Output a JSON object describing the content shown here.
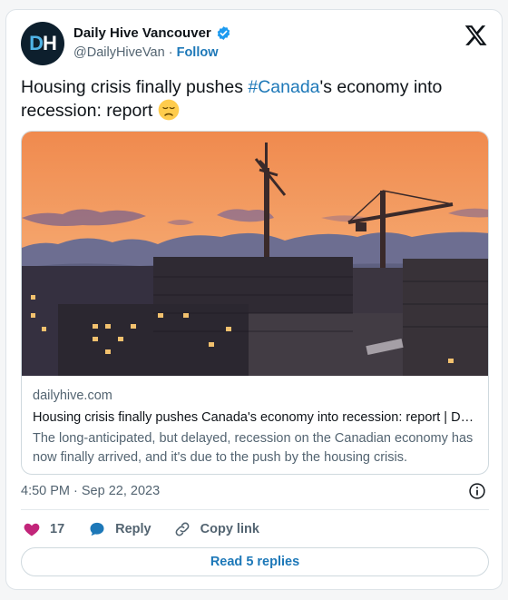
{
  "author": {
    "avatar_text_d": "D",
    "avatar_text_h": "H",
    "name": "Daily Hive Vancouver",
    "handle": "@DailyHiveVan",
    "separator": "·",
    "follow_label": "Follow"
  },
  "tweet": {
    "text_before": "Housing crisis finally pushes ",
    "hashtag": "#Canada",
    "text_after": "'s economy into recession: report",
    "emoji": "disappointed-face"
  },
  "link_card": {
    "domain": "dailyhive.com",
    "title": "Housing crisis finally pushes Canada's economy into recession: report | Daily Hive Vancouver",
    "description": "The long-anticipated, but delayed, recession on the Canadian economy has now finally arrived, and it's due to the push by the housing crisis."
  },
  "timestamp": "4:50 PM · Sep 22, 2023",
  "actions": {
    "like_count": "17",
    "reply_label": "Reply",
    "copy_link_label": "Copy link"
  },
  "read_replies_label": "Read 5 replies",
  "colors": {
    "accent": "#1d78b8",
    "heart": "#c2257a",
    "verified": "#1d9bf0"
  }
}
